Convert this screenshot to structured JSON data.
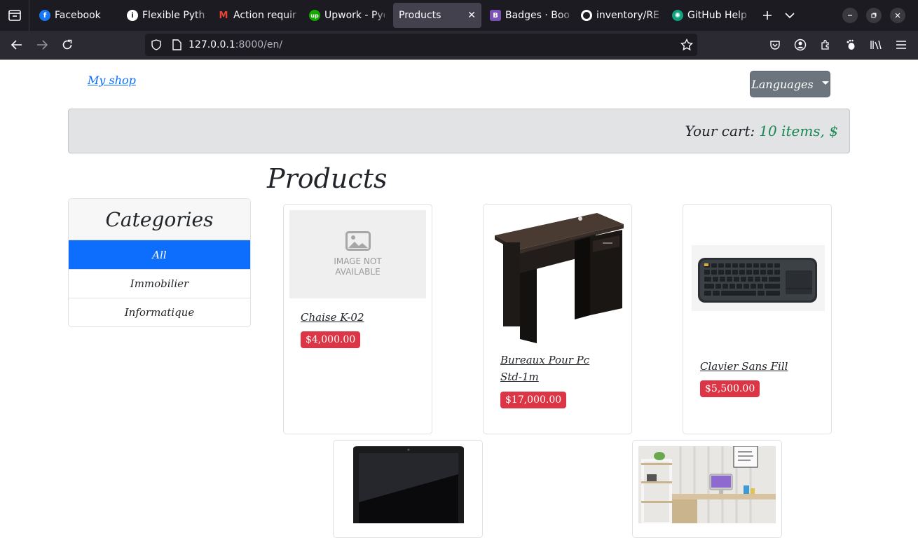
{
  "browser": {
    "tabs": [
      {
        "label": "Facebook",
        "icon": "facebook-icon",
        "color": "#1877f2",
        "glyph": "f"
      },
      {
        "label": "Flexible Pyth",
        "icon": "info-icon",
        "color": "#ffffff",
        "glyph": "i"
      },
      {
        "label": "Action requir",
        "icon": "gmail-icon",
        "color": "#ea4335",
        "glyph": "M"
      },
      {
        "label": "Upwork - Pyq",
        "icon": "upwork-icon",
        "color": "#14a800",
        "glyph": "up"
      },
      {
        "label": "Products",
        "icon": "",
        "color": "",
        "glyph": ""
      },
      {
        "label": "Badges · Boo",
        "icon": "bootstrap-icon",
        "color": "#7952b3",
        "glyph": "B"
      },
      {
        "label": "inventory/RE",
        "icon": "github-icon",
        "color": "#ffffff",
        "glyph": "●"
      },
      {
        "label": "GitHub Help",
        "icon": "chatgpt-icon",
        "color": "#10a37f",
        "glyph": "✺"
      }
    ],
    "active_tab": "Products",
    "url_host": "127.0.0.1",
    "url_rest": ":8000/en/"
  },
  "page": {
    "brand": "My shop",
    "languages_label": "Languages",
    "cart_label": "Your cart:",
    "cart_value": "10 items, $",
    "title": "Products",
    "categories_title": "Categories",
    "categories": [
      "All",
      "Immobilier",
      "Informatique"
    ],
    "active_category": "All",
    "no_image_text": "IMAGE NOT AVAILABLE",
    "products": [
      {
        "name": "Chaise K-02",
        "price": "$4,000.00"
      },
      {
        "name": "Bureaux Pour Pc Std-1m",
        "price": "$17,000.00"
      },
      {
        "name": "Clavier Sans Fill",
        "price": "$5,500.00"
      }
    ]
  },
  "colors": {
    "primary": "#0d6efd",
    "danger": "#dc3545",
    "success": "#198754",
    "secondary": "#6c757d"
  }
}
